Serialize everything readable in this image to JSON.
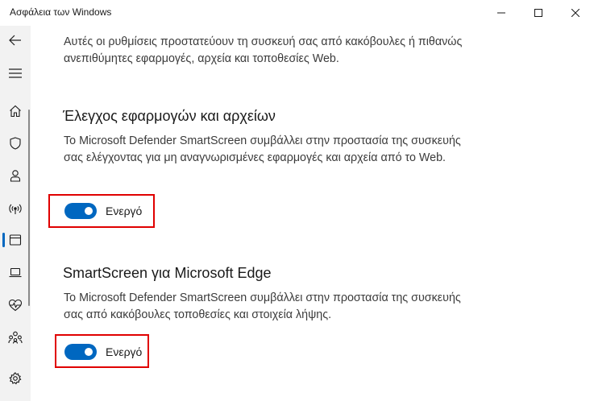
{
  "window": {
    "title": "Ασφάλεια των Windows"
  },
  "intro_text": "Αυτές οι ρυθμίσεις προστατεύουν τη συσκευή σας από κακόβουλες ή πιθανώς ανεπιθύμητες εφαρμογές, αρχεία και τοποθεσίες Web.",
  "sections": [
    {
      "heading": "Έλεγχος εφαρμογών και αρχείων",
      "description": "Το Microsoft Defender SmartScreen συμβάλλει στην προστασία της συσκευής σας ελέγχοντας για μη αναγνωρισμένες εφαρμογές και αρχεία από το Web.",
      "toggle": {
        "on": true,
        "label": "Ενεργό"
      }
    },
    {
      "heading": "SmartScreen για Microsoft Edge",
      "description": "Το Microsoft Defender SmartScreen συμβάλλει στην προστασία της συσκευής σας από κακόβουλες τοποθεσίες και στοιχεία λήψης.",
      "toggle": {
        "on": true,
        "label": "Ενεργό"
      }
    }
  ],
  "sidebar": {
    "items": [
      {
        "icon": "back-arrow-icon"
      },
      {
        "icon": "hamburger-menu-icon"
      },
      {
        "icon": "home-icon"
      },
      {
        "icon": "shield-icon"
      },
      {
        "icon": "person-icon"
      },
      {
        "icon": "wireless-signal-icon"
      },
      {
        "icon": "app-browser-window-icon",
        "active": true
      },
      {
        "icon": "laptop-icon"
      },
      {
        "icon": "heart-pulse-icon"
      },
      {
        "icon": "family-icon"
      },
      {
        "icon": "gear-icon"
      }
    ]
  },
  "colors": {
    "accent": "#0067c0",
    "highlight_box": "#e00000",
    "sidebar_bg": "#f2f2f2"
  }
}
